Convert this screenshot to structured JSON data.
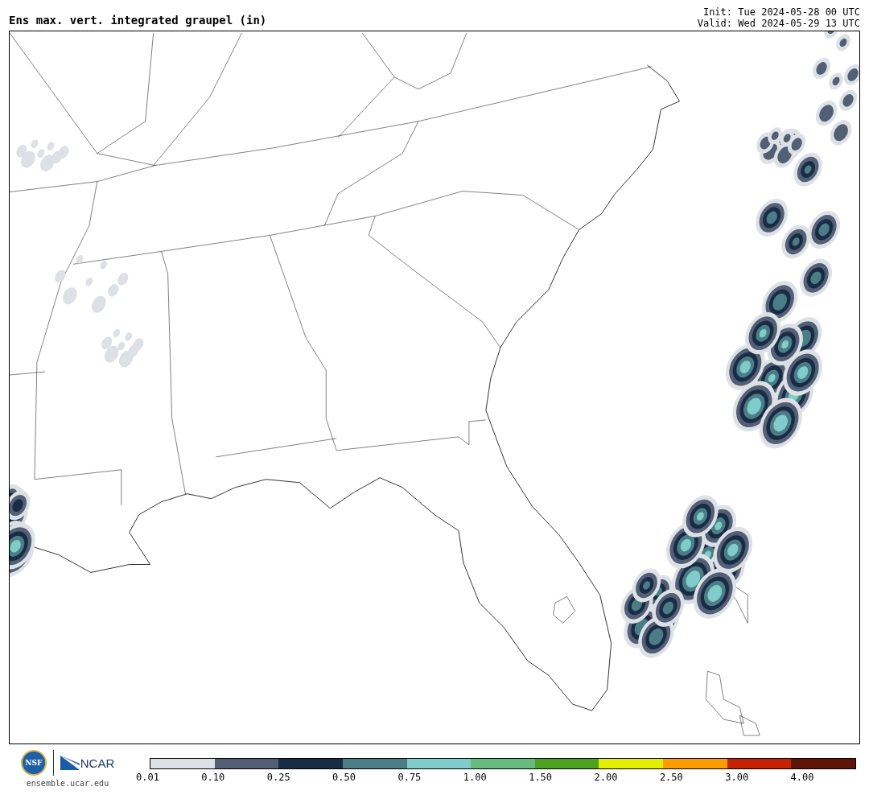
{
  "title": "Ens max. vert. integrated graupel (in)",
  "init": "Init: Tue 2024-05-28 00 UTC",
  "valid": "Valid: Wed 2024-05-29 13 UTC",
  "logos": {
    "nsf_text": "NSF",
    "ncar_text": "NCAR",
    "url": "ensemble.ucar.edu"
  },
  "colorbar": {
    "segments": [
      {
        "label": "0.01",
        "color": "#dde1e6"
      },
      {
        "label": "0.10",
        "color": "#525f75"
      },
      {
        "label": "0.25",
        "color": "#1a2b45"
      },
      {
        "label": "0.50",
        "color": "#4a7d85"
      },
      {
        "label": "0.75",
        "color": "#7fcccb"
      },
      {
        "label": "1.00",
        "color": "#66bb7f"
      },
      {
        "label": "1.50",
        "color": "#4ea222"
      },
      {
        "label": "2.00",
        "color": "#e2f000"
      },
      {
        "label": "2.50",
        "color": "#ff9c00"
      },
      {
        "label": "3.00",
        "color": "#c42200"
      },
      {
        "label": "4.00",
        "color": "#5e140a"
      }
    ]
  }
}
